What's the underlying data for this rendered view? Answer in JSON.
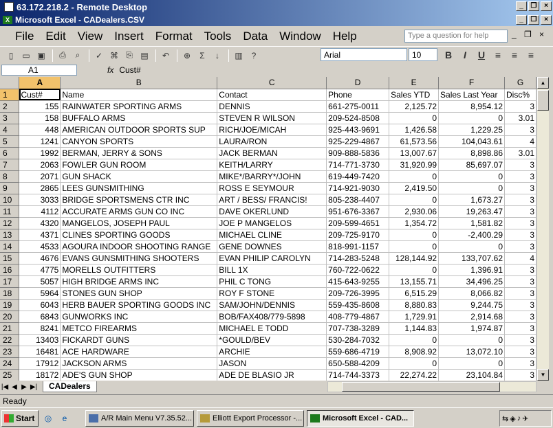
{
  "remote_desktop": {
    "title": "63.172.218.2 - Remote Desktop"
  },
  "excel_window": {
    "title": "Microsoft Excel - CADealers.CSV"
  },
  "menu": {
    "items": [
      "File",
      "Edit",
      "View",
      "Insert",
      "Format",
      "Tools",
      "Data",
      "Window",
      "Help"
    ],
    "ask_placeholder": "Type a question for help"
  },
  "toolbar": {
    "font": "Arial",
    "size": "10"
  },
  "formula_bar": {
    "name_box": "A1",
    "fx": "fx",
    "value": "Cust#"
  },
  "columns": [
    "A",
    "B",
    "C",
    "D",
    "E",
    "F",
    "G"
  ],
  "rows": [
    [
      "1",
      "Cust#",
      "Name",
      "Contact",
      "Phone",
      "Sales YTD",
      "Sales Last Year",
      "Disc%"
    ],
    [
      "2",
      "155",
      "RAINWATER SPORTING ARMS",
      "DENNIS",
      "661-275-0011",
      "2,125.72",
      "8,954.12",
      "3"
    ],
    [
      "3",
      "158",
      "BUFFALO ARMS",
      "STEVEN R WILSON",
      "209-524-8508",
      "0",
      "0",
      "3.01"
    ],
    [
      "4",
      "448",
      "AMERICAN OUTDOOR SPORTS SUP",
      "RICH/JOE/MICAH",
      "925-443-9691",
      "1,426.58",
      "1,229.25",
      "3"
    ],
    [
      "5",
      "1241",
      "CANYON SPORTS",
      "LAURA/RON",
      "925-229-4867",
      "61,573.56",
      "104,043.61",
      "4"
    ],
    [
      "6",
      "1992",
      "BERMAN, JERRY & SONS",
      "JACK BERMAN",
      "909-888-5836",
      "13,007.67",
      "8,898.86",
      "3.01"
    ],
    [
      "7",
      "2063",
      "FOWLER GUN ROOM",
      "KEITH/LARRY",
      "714-771-3730",
      "31,920.99",
      "85,697.07",
      "3"
    ],
    [
      "8",
      "2071",
      "GUN SHACK",
      "MIKE*/BARRY*/JOHN",
      "619-449-7420",
      "0",
      "0",
      "3"
    ],
    [
      "9",
      "2865",
      "LEES GUNSMITHING",
      "ROSS E SEYMOUR",
      "714-921-9030",
      "2,419.50",
      "0",
      "3"
    ],
    [
      "10",
      "3033",
      "BRIDGE SPORTSMENS CTR INC",
      "ART / BESS/ FRANCIS!",
      "805-238-4407",
      "0",
      "1,673.27",
      "3"
    ],
    [
      "11",
      "4112",
      "ACCURATE ARMS GUN CO INC",
      "DAVE OKERLUND",
      "951-676-3367",
      "2,930.06",
      "19,263.47",
      "3"
    ],
    [
      "12",
      "4320",
      "MANGELOS, JOSEPH PAUL",
      "JOE P MANGELOS",
      "209-599-4651",
      "1,354.72",
      "1,581.82",
      "3"
    ],
    [
      "13",
      "4371",
      "CLINES SPORTING GOODS",
      "MICHAEL CLINE",
      "209-725-9170",
      "0",
      "-2,400.29",
      "3"
    ],
    [
      "14",
      "4533",
      "AGOURA INDOOR SHOOTING RANGE",
      "GENE DOWNES",
      "818-991-1157",
      "0",
      "0",
      "3"
    ],
    [
      "15",
      "4676",
      "EVANS GUNSMITHING SHOOTERS",
      "EVAN PHILIP CAROLYN",
      "714-283-5248",
      "128,144.92",
      "133,707.62",
      "4"
    ],
    [
      "16",
      "4775",
      "MORELLS OUTFITTERS",
      "BILL            1X",
      "760-722-0622",
      "0",
      "1,396.91",
      "3"
    ],
    [
      "17",
      "5057",
      "HIGH BRIDGE ARMS INC",
      "PHIL C TONG",
      "415-643-9255",
      "13,155.71",
      "34,496.25",
      "3"
    ],
    [
      "18",
      "5964",
      "STONES GUN SHOP",
      "ROY F STONE",
      "209-726-3995",
      "6,515.29",
      "8,066.82",
      "3"
    ],
    [
      "19",
      "6043",
      "HERB BAUER SPORTING GOODS INC",
      "SAM/JOHN/DENNIS",
      "559-435-8608",
      "8,880.83",
      "9,244.75",
      "3"
    ],
    [
      "20",
      "6843",
      "GUNWORKS INC",
      "BOB/FAX408/779-5898",
      "408-779-4867",
      "1,729.91",
      "2,914.68",
      "3"
    ],
    [
      "21",
      "8241",
      "METCO FIREARMS",
      "MICHAEL E TODD",
      "707-738-3289",
      "1,144.83",
      "1,974.87",
      "3"
    ],
    [
      "22",
      "13403",
      "FICKARDT GUNS",
      "*GOULD/BEV",
      "530-284-7032",
      "0",
      "0",
      "3"
    ],
    [
      "23",
      "16481",
      "ACE HARDWARE",
      "ARCHIE",
      "559-686-4719",
      "8,908.92",
      "13,072.10",
      "3"
    ],
    [
      "24",
      "17912",
      "JACKSON ARMS",
      "JASON",
      "650-588-4209",
      "0",
      "0",
      "3"
    ],
    [
      "25",
      "18172",
      "ADE'S GUN SHOP",
      "ADE DE BLASIO JR",
      "714-744-3373",
      "22,274.22",
      "23,104.84",
      "3"
    ]
  ],
  "sheet_tab": "CADealers",
  "status": "Ready",
  "taskbar": {
    "start": "Start",
    "tasks": [
      "A/R Main Menu V7.35.52...",
      "Elliott Export Processor -...",
      "Microsoft Excel - CAD..."
    ]
  }
}
